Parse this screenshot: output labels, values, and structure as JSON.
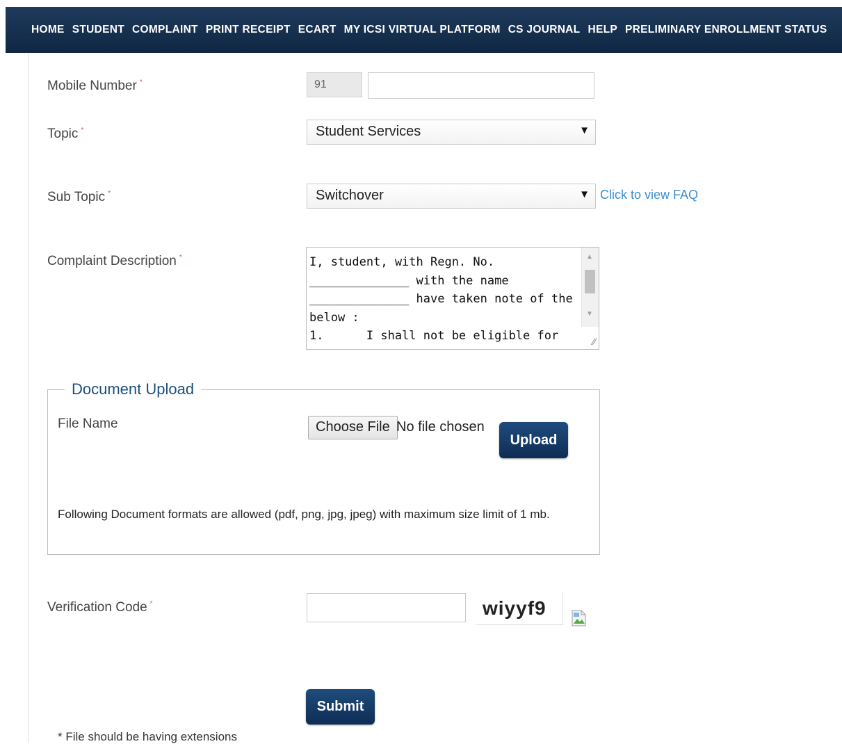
{
  "nav": {
    "items": [
      "HOME",
      "STUDENT",
      "COMPLAINT",
      "PRINT RECEIPT",
      "ECART",
      "MY ICSI VIRTUAL PLATFORM",
      "CS JOURNAL",
      "HELP",
      "PRELIMINARY ENROLLMENT STATUS"
    ]
  },
  "form": {
    "required_mark": "*",
    "mobile": {
      "label": "Mobile Number",
      "country_code": "91",
      "value": ""
    },
    "topic": {
      "label": "Topic",
      "selected": "Student Services"
    },
    "subtopic": {
      "label": "Sub Topic",
      "selected": "Switchover",
      "faq_link": "Click to view FAQ"
    },
    "description": {
      "label": "Complaint Description",
      "value": "I, student, with Regn. No. ______________ with the name ______________ have taken note of the below :\n1.      I shall not be eligible for"
    },
    "upload": {
      "legend": "Document Upload",
      "file_label": "File Name",
      "choose_button": "Choose File",
      "no_file": "No file chosen",
      "upload_button": "Upload",
      "formats_note": "Following Document formats are allowed (pdf, png, jpg, jpeg) with maximum size limit of 1 mb."
    },
    "verification": {
      "label": "Verification Code",
      "value": "",
      "captcha": "wiyyf9"
    },
    "submit_button": "Submit",
    "footnote": "* File should be having extensions"
  },
  "icons": {
    "dropdown": "caret-down-icon",
    "refresh": "broken-image-icon"
  },
  "colors": {
    "nav_bg": "#0f2744",
    "button_bg": "#0e2d55",
    "link": "#3b8ed1",
    "required": "#e05a5a",
    "legend": "#1d4f7c"
  }
}
